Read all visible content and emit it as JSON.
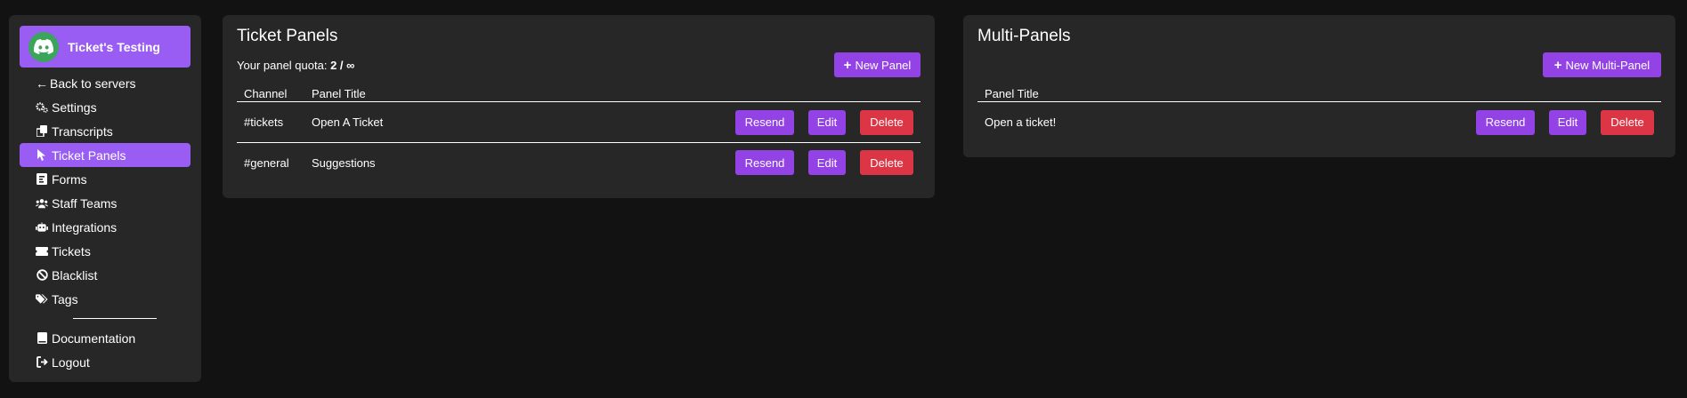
{
  "sidebar": {
    "guild_name": "Ticket's Testing",
    "back_label": "Back to servers",
    "items": [
      {
        "label": "Settings",
        "icon": "cogs-icon"
      },
      {
        "label": "Transcripts",
        "icon": "copy-icon"
      },
      {
        "label": "Ticket Panels",
        "icon": "mouse-pointer-icon",
        "active": true
      },
      {
        "label": "Forms",
        "icon": "form-icon"
      },
      {
        "label": "Staff Teams",
        "icon": "users-icon"
      },
      {
        "label": "Integrations",
        "icon": "robot-icon"
      },
      {
        "label": "Tickets",
        "icon": "ticket-icon"
      },
      {
        "label": "Blacklist",
        "icon": "ban-icon"
      },
      {
        "label": "Tags",
        "icon": "tags-icon"
      }
    ],
    "bottom": [
      {
        "label": "Documentation",
        "icon": "book-icon"
      },
      {
        "label": "Logout",
        "icon": "sign-out-icon"
      }
    ]
  },
  "panels": {
    "title": "Ticket Panels",
    "quota_label": "Your panel quota:",
    "quota_value": "2 / ∞",
    "new_button": "New Panel",
    "columns": [
      "Channel",
      "Panel Title"
    ],
    "rows": [
      {
        "channel": "#tickets",
        "title": "Open A Ticket"
      },
      {
        "channel": "#general",
        "title": "Suggestions"
      }
    ],
    "actions": {
      "resend": "Resend",
      "edit": "Edit",
      "delete": "Delete"
    }
  },
  "multipanels": {
    "title": "Multi-Panels",
    "new_button": "New Multi-Panel",
    "columns": [
      "Panel Title"
    ],
    "rows": [
      {
        "title": "Open a ticket!"
      }
    ],
    "actions": {
      "resend": "Resend",
      "edit": "Edit",
      "delete": "Delete"
    }
  },
  "colors": {
    "accent": "#995df3",
    "button_purple": "#9342e6",
    "button_red": "#dc3545",
    "card": "#272727",
    "background": "#121212"
  }
}
